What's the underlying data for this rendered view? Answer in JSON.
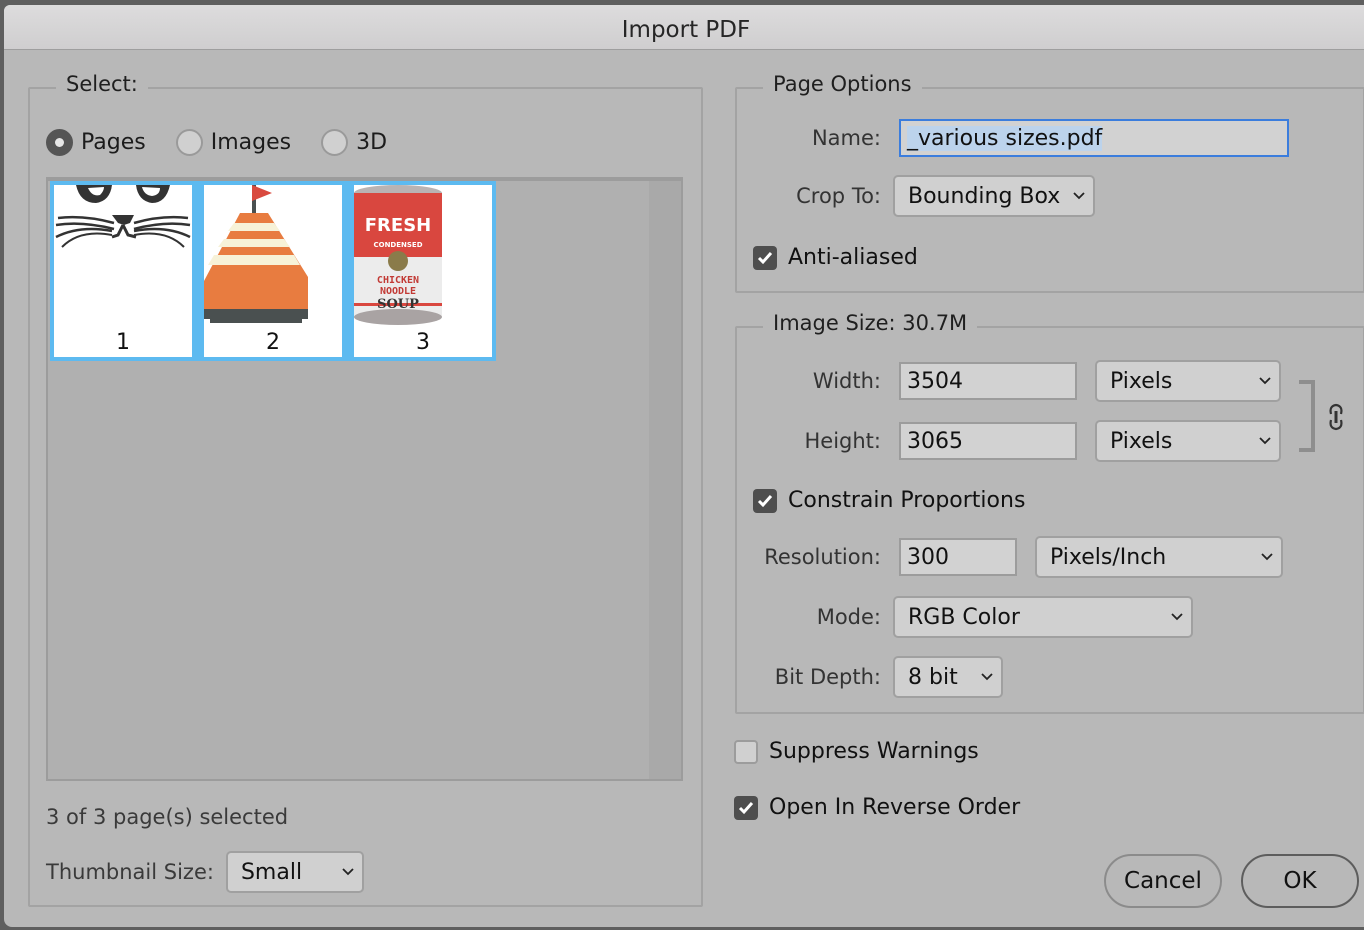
{
  "window": {
    "title": "Import PDF"
  },
  "select_panel": {
    "legend": "Select:",
    "radios": [
      {
        "label": "Pages",
        "selected": true
      },
      {
        "label": "Images",
        "selected": false
      },
      {
        "label": "3D",
        "selected": false
      }
    ],
    "thumbnails": [
      {
        "page": "1",
        "subject": "cat-face",
        "selected": true
      },
      {
        "page": "2",
        "subject": "buoy",
        "selected": true
      },
      {
        "page": "3",
        "subject": "soup-can",
        "selected": true,
        "text": [
          "FRESH",
          "CONDENSED",
          "CHICKEN",
          "NOODLE",
          "SOUP"
        ]
      }
    ],
    "selection_status": "3 of 3 page(s) selected",
    "thumbnail_size": {
      "label": "Thumbnail Size:",
      "value": "Small"
    }
  },
  "page_options": {
    "legend": "Page Options",
    "name": {
      "label": "Name:",
      "value": "_various sizes.pdf"
    },
    "crop_to": {
      "label": "Crop To:",
      "value": "Bounding Box"
    },
    "anti_aliased": {
      "label": "Anti-aliased",
      "checked": true
    }
  },
  "image_size": {
    "legend": "Image Size: 30.7M",
    "width": {
      "label": "Width:",
      "value": "3504",
      "unit": "Pixels"
    },
    "height": {
      "label": "Height:",
      "value": "3065",
      "unit": "Pixels"
    },
    "link_icon": "chain-link-icon",
    "constrain": {
      "label": "Constrain Proportions",
      "checked": true
    },
    "resolution": {
      "label": "Resolution:",
      "value": "300",
      "unit": "Pixels/Inch"
    },
    "mode": {
      "label": "Mode:",
      "value": "RGB Color"
    },
    "bit_depth": {
      "label": "Bit Depth:",
      "value": "8 bit"
    }
  },
  "options": {
    "suppress_warnings": {
      "label": "Suppress Warnings",
      "checked": false
    },
    "reverse_order": {
      "label": "Open In Reverse Order",
      "checked": true
    }
  },
  "buttons": {
    "cancel": "Cancel",
    "ok": "OK"
  },
  "colors": {
    "selection": "#5dbaf0",
    "focus_ring": "#3b7ddd",
    "text_selection": "#bcd3ec"
  }
}
